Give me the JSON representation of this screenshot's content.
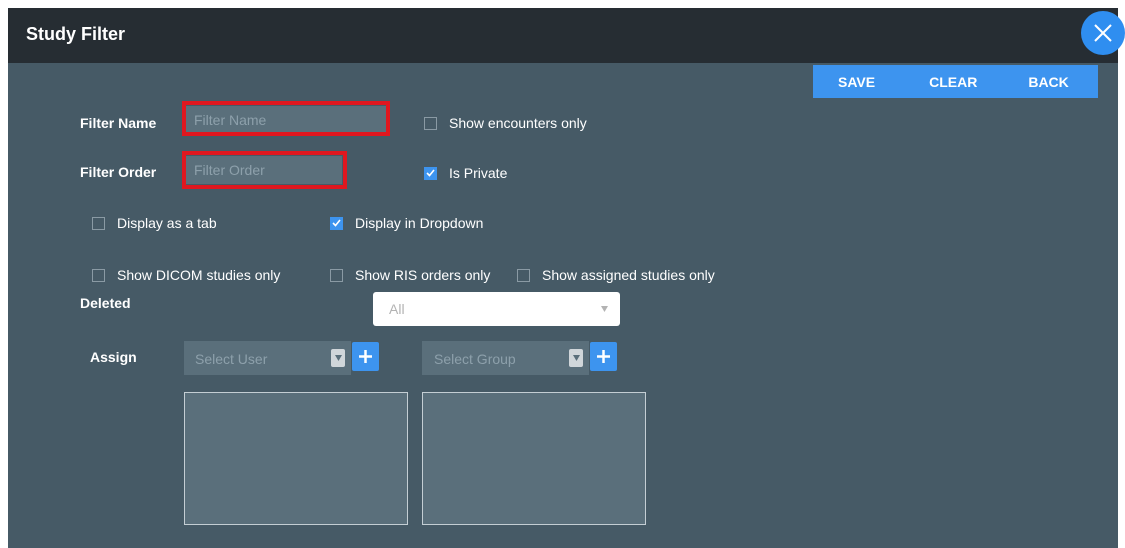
{
  "dialog": {
    "title": "Study Filter",
    "close_icon": "close-icon"
  },
  "toolbar": {
    "save_label": "SAVE",
    "clear_label": "CLEAR",
    "back_label": "BACK"
  },
  "form": {
    "filter_name": {
      "label": "Filter Name",
      "value": "",
      "placeholder": "Filter Name"
    },
    "filter_order": {
      "label": "Filter Order",
      "value": "",
      "placeholder": "Filter Order"
    },
    "checkboxes": {
      "show_encounters_only": {
        "label": "Show encounters only",
        "checked": false
      },
      "is_private": {
        "label": "Is Private",
        "checked": true
      },
      "display_as_tab": {
        "label": "Display as a tab",
        "checked": false
      },
      "display_in_dropdown": {
        "label": "Display in Dropdown",
        "checked": true
      },
      "show_dicom_only": {
        "label": "Show DICOM studies only",
        "checked": false
      },
      "show_ris_only": {
        "label": "Show RIS orders only",
        "checked": false
      },
      "show_assigned_only": {
        "label": "Show assigned studies only",
        "checked": false
      }
    },
    "deleted": {
      "label": "Deleted",
      "selected": "All"
    },
    "assign": {
      "label": "Assign",
      "user_placeholder": "Select User",
      "group_placeholder": "Select Group"
    }
  },
  "colors": {
    "title_bar": "#262d33",
    "panel": "#465a66",
    "accent": "#3d94ef",
    "highlight": "#e0171f"
  }
}
